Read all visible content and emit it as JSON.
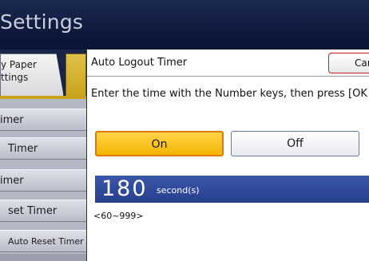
{
  "header": {
    "title": "Settings"
  },
  "tabs": {
    "paper_line1": "y Paper",
    "paper_line2": "ttings"
  },
  "menu": [
    {
      "label": "imer"
    },
    {
      "label": "Timer"
    },
    {
      "label": "imer"
    },
    {
      "label": "set Timer"
    },
    {
      "label": "Auto Reset Timer"
    }
  ],
  "dialog": {
    "title": "Auto Logout Timer",
    "cancel_label": "Car",
    "instruction": "Enter the time with the Number keys, then press [OK",
    "toggle_on": "On",
    "toggle_off": "Off",
    "selected": "On",
    "value": "180",
    "unit": "second(s)",
    "range": "<60~999>"
  },
  "colors": {
    "header_bg": "#0f1a3d",
    "selected_toggle": "#f4b400",
    "value_bar": "#2f4a9c",
    "cancel_border": "#d0201c"
  }
}
